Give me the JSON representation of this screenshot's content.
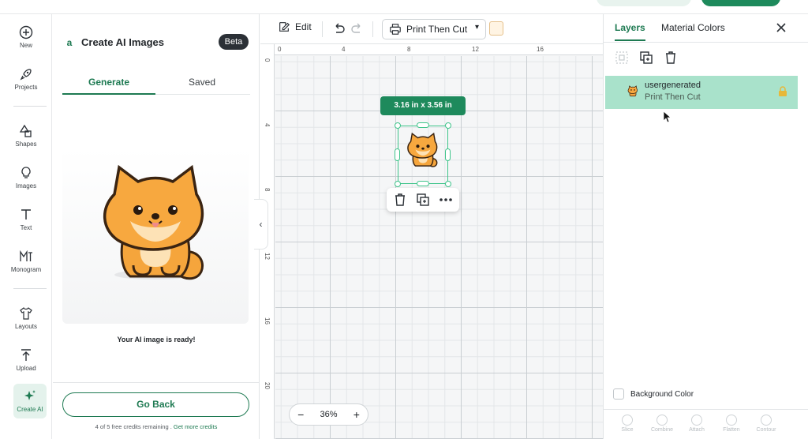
{
  "rail": {
    "items": [
      {
        "label": "New",
        "icon": "plus-circle-icon"
      },
      {
        "label": "Projects",
        "icon": "rocket-icon"
      },
      {
        "label": "Shapes",
        "icon": "shapes-icon"
      },
      {
        "label": "Images",
        "icon": "lightbulb-icon"
      },
      {
        "label": "Text",
        "icon": "text-icon"
      },
      {
        "label": "Monogram",
        "icon": "monogram-icon"
      },
      {
        "label": "Layouts",
        "icon": "shirt-icon"
      },
      {
        "label": "Upload",
        "icon": "upload-icon"
      },
      {
        "label": "Create AI",
        "icon": "sparkle-icon"
      }
    ]
  },
  "panel": {
    "title": "Create AI Images",
    "badge": "Beta",
    "tabs": [
      {
        "label": "Generate"
      },
      {
        "label": "Saved"
      }
    ],
    "status": "Your AI image is ready!",
    "go_back": "Go Back",
    "credits_text": "4 of 5 free credits remaining . ",
    "credits_link": "Get more credits"
  },
  "canvas_toolbar": {
    "edit_label": "Edit",
    "operation": "Print Then Cut"
  },
  "canvas": {
    "ruler_top": [
      "0",
      "4",
      "8",
      "12",
      "16"
    ],
    "ruler_left": [
      "0",
      "4",
      "8",
      "12",
      "16",
      "20"
    ],
    "dimensions": "3.16  in x 3.56  in",
    "zoom": "36%",
    "zoom_minus": "−",
    "zoom_plus": "+"
  },
  "layers": {
    "tabs": [
      {
        "label": "Layers"
      },
      {
        "label": "Material Colors"
      }
    ],
    "row": {
      "name": "usergenerated",
      "operation": "Print Then Cut"
    },
    "background_color": "Background Color",
    "footer": [
      "Slice",
      "Combine",
      "Attach",
      "Flatten",
      "Contour"
    ]
  },
  "colors": {
    "accent": "#1e7a52",
    "selection": "#3ec48a",
    "layer_highlight": "#a9e2cb"
  }
}
